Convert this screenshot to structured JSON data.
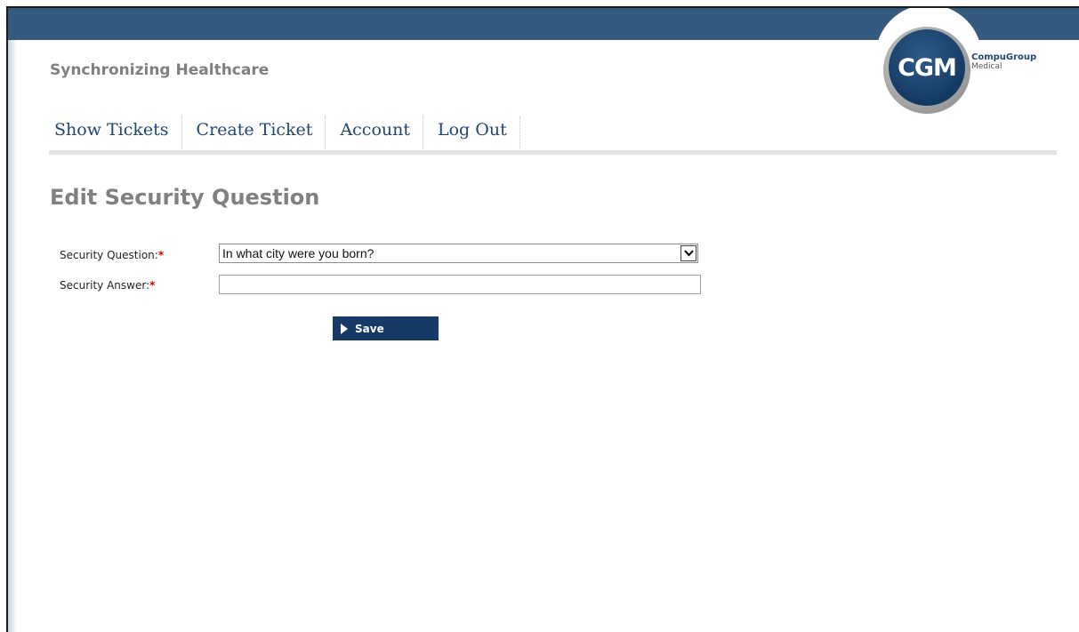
{
  "header": {
    "tagline": "Synchronizing Healthcare",
    "logo": {
      "mark": "CGM",
      "line1": "CompuGroup",
      "line2": "Medical"
    },
    "bar_color": "#355a80"
  },
  "nav": {
    "items": [
      {
        "label": "Show Tickets"
      },
      {
        "label": "Create Ticket"
      },
      {
        "label": "Account"
      },
      {
        "label": "Log Out"
      }
    ]
  },
  "main": {
    "title": "Edit Security Question",
    "form": {
      "question_label": "Security Question:",
      "answer_label": "Security Answer:",
      "required_marker": "*",
      "question_selected": "In what city were you born?",
      "answer_value": "",
      "save_label": "Save"
    }
  },
  "colors": {
    "accent": "#163a66",
    "required": "#d40000"
  }
}
